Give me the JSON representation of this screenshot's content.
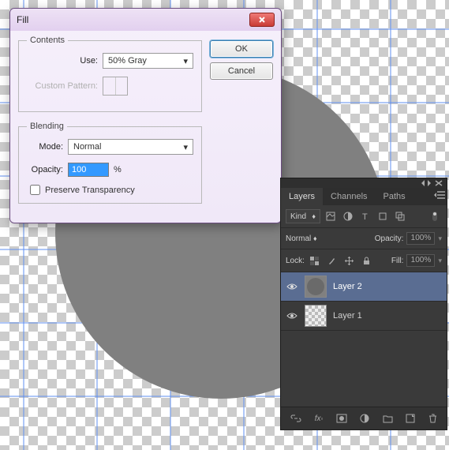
{
  "dialog": {
    "title": "Fill",
    "contents": {
      "legend": "Contents",
      "use_label": "Use:",
      "use_value": "50% Gray",
      "pattern_label": "Custom Pattern:"
    },
    "blending": {
      "legend": "Blending",
      "mode_label": "Mode:",
      "mode_value": "Normal",
      "opacity_label": "Opacity:",
      "opacity_value": "100",
      "opacity_suffix": "%",
      "preserve_label": "Preserve Transparency"
    },
    "buttons": {
      "ok": "OK",
      "cancel": "Cancel"
    }
  },
  "panel": {
    "tabs": {
      "layers": "Layers",
      "channels": "Channels",
      "paths": "Paths"
    },
    "kind_label": "Kind",
    "blend_mode": "Normal",
    "opacity_label": "Opacity:",
    "opacity_value": "100%",
    "lock_label": "Lock:",
    "fill_label": "Fill:",
    "fill_value": "100%",
    "layers": [
      {
        "name": "Layer 2",
        "selected": true
      },
      {
        "name": "Layer 1",
        "selected": false
      }
    ],
    "footer": {
      "fx": "fx"
    }
  }
}
